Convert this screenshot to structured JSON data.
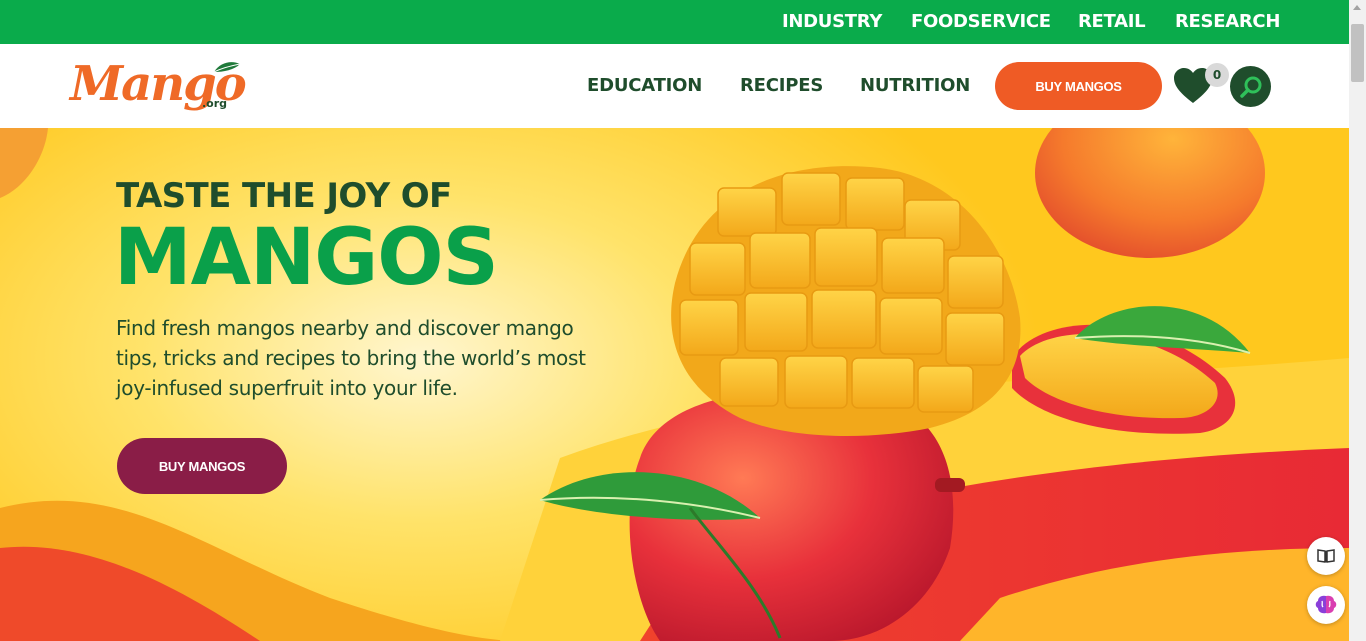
{
  "top_nav": {
    "items": [
      "INDUSTRY",
      "FOODSERVICE",
      "RETAIL",
      "RESEARCH"
    ]
  },
  "logo": {
    "text": "Mango",
    "suffix": ".org"
  },
  "main_nav": {
    "items": [
      "EDUCATION",
      "RECIPES",
      "NUTRITION"
    ],
    "buy_label": "BUY MANGOS",
    "favorites_count": "0"
  },
  "hero": {
    "kicker": "TASTE THE JOY OF",
    "headline": "MANGOS",
    "lead": "Find fresh mangos nearby and discover mango tips, tricks and recipes to bring the world’s most joy-infused superfruit into your life.",
    "cta_label": "BUY MANGOS"
  },
  "colors": {
    "top_bar": "#0aab4b",
    "brand_orange": "#ef5b25",
    "dark_green": "#1f4d2c",
    "hero_green": "#0aa04a",
    "cta_maroon": "#8a1d47"
  },
  "icons": [
    "leaf-icon",
    "heart-icon",
    "search-icon",
    "book-icon",
    "brain-icon"
  ]
}
